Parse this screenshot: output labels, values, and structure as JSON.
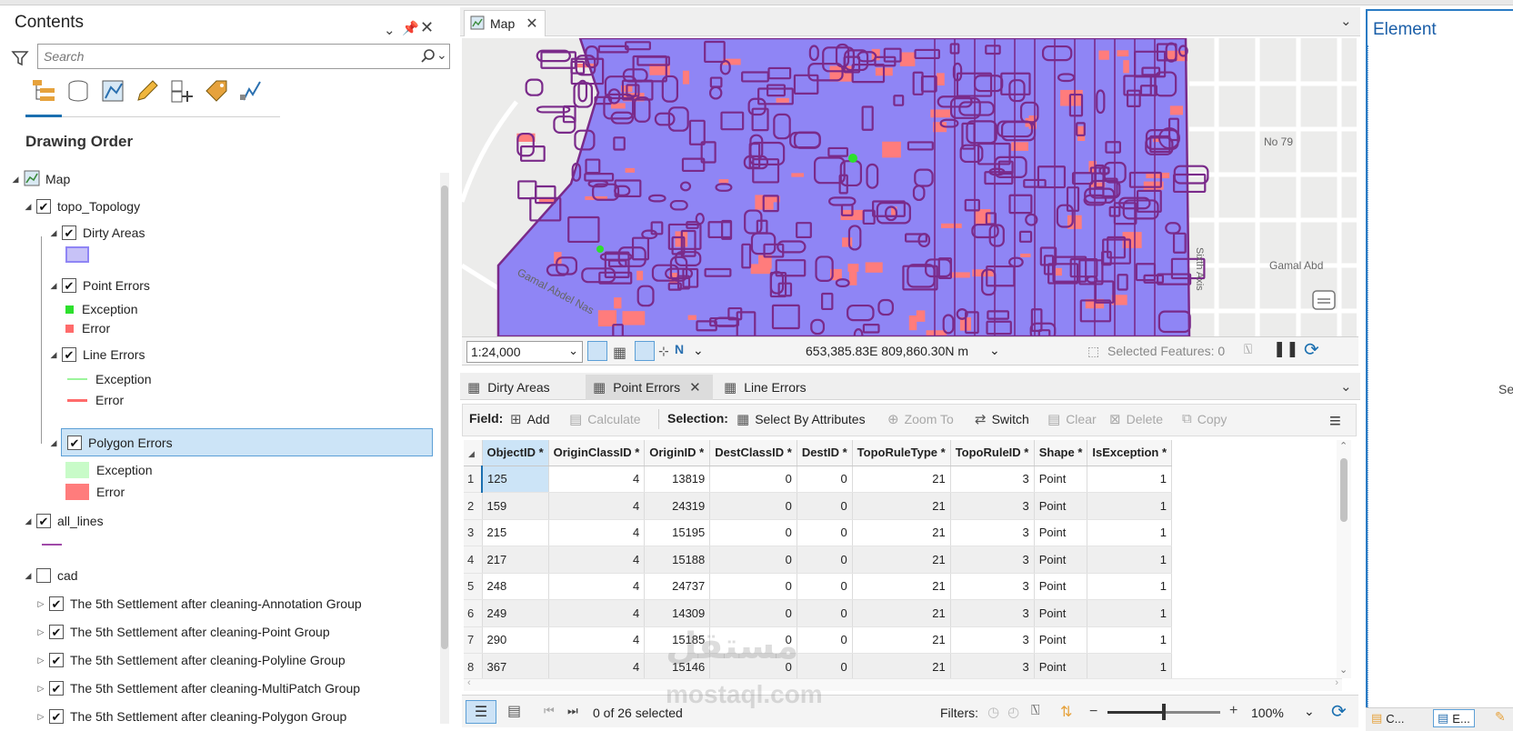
{
  "contents": {
    "title": "Contents",
    "search_placeholder": "Search",
    "section_title": "Drawing Order",
    "layers": {
      "map": "Map",
      "topology": "topo_Topology",
      "dirty_areas": "Dirty Areas",
      "point_errors": "Point Errors",
      "line_errors": "Line Errors",
      "polygon_errors": "Polygon Errors",
      "exception": "Exception",
      "error": "Error",
      "all_lines": "all_lines",
      "cad": "cad",
      "cad_groups": [
        "The 5th Settlement after cleaning-Annotation Group",
        "The 5th Settlement after cleaning-Point Group",
        "The 5th Settlement after cleaning-Polyline Group",
        "The 5th Settlement after cleaning-MultiPatch Group",
        "The 5th Settlement after cleaning-Polygon Group"
      ]
    }
  },
  "map": {
    "tab_label": "Map",
    "scale": "1:24,000",
    "coordinates": "653,385.83E 809,860.30N m",
    "selected_features": "Selected Features: 0",
    "labels": {
      "road_left": "Gamal Abdel Nas",
      "road_right": "Gamal Abd",
      "no79": "No 79",
      "sixth_axis": "Sixth Axis"
    }
  },
  "table_tabs": [
    "Dirty Areas",
    "Point Errors",
    "Line Errors"
  ],
  "toolbar": {
    "field_label": "Field:",
    "add": "Add",
    "calculate": "Calculate",
    "selection_label": "Selection:",
    "select_by_attributes": "Select By Attributes",
    "zoom_to": "Zoom To",
    "switch": "Switch",
    "clear": "Clear",
    "delete": "Delete",
    "copy": "Copy"
  },
  "table": {
    "columns": [
      "ObjectID *",
      "OriginClassID *",
      "OriginID *",
      "DestClassID *",
      "DestID *",
      "TopoRuleType *",
      "TopoRuleID *",
      "Shape *",
      "IsException *"
    ],
    "rows": [
      [
        "125",
        "4",
        "13819",
        "0",
        "0",
        "21",
        "3",
        "Point",
        "1"
      ],
      [
        "159",
        "4",
        "24319",
        "0",
        "0",
        "21",
        "3",
        "Point",
        "1"
      ],
      [
        "215",
        "4",
        "15195",
        "0",
        "0",
        "21",
        "3",
        "Point",
        "1"
      ],
      [
        "217",
        "4",
        "15188",
        "0",
        "0",
        "21",
        "3",
        "Point",
        "1"
      ],
      [
        "248",
        "4",
        "24737",
        "0",
        "0",
        "21",
        "3",
        "Point",
        "1"
      ],
      [
        "249",
        "4",
        "14309",
        "0",
        "0",
        "21",
        "3",
        "Point",
        "1"
      ],
      [
        "290",
        "4",
        "15185",
        "0",
        "0",
        "21",
        "3",
        "Point",
        "1"
      ],
      [
        "367",
        "4",
        "15146",
        "0",
        "0",
        "21",
        "3",
        "Point",
        "1"
      ]
    ]
  },
  "status": {
    "selected_count": "0 of 26 selected",
    "filters_label": "Filters:",
    "zoom": "100%",
    "zoom_fraction": 0.5
  },
  "right_pane": {
    "title": "Element",
    "partial_text": "Se",
    "bottom_tabs": [
      "C...",
      "E..."
    ]
  },
  "watermark": {
    "arabic": "مستقل",
    "latin": "mostaql.com"
  },
  "colors": {
    "accent": "#1a6fb0",
    "dirty_area": "#8f85f5",
    "error_red": "#ff7c7c",
    "exception_green": "#9cf59c",
    "all_lines_purple": "#a04aa8",
    "selected_row": "#cce4f7"
  }
}
